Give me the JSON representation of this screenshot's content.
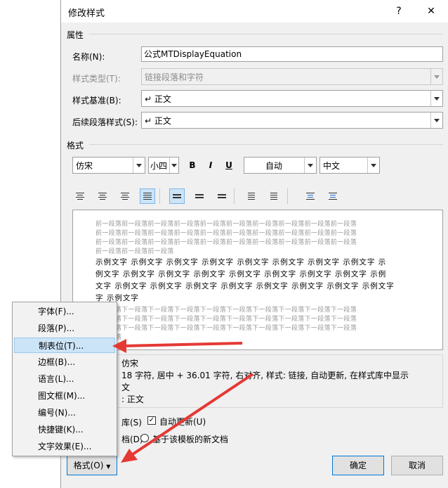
{
  "dialog": {
    "title": "修改样式",
    "help": "?",
    "close": "✕"
  },
  "properties": {
    "section": "属性",
    "name_label": "名称(N):",
    "name_value": "公式MTDisplayEquation",
    "type_label": "样式类型(T):",
    "type_value": "链接段落和字符",
    "based_label": "样式基准(B):",
    "based_value": "↵ 正文",
    "next_label": "后续段落样式(S):",
    "next_value": "↵ 正文"
  },
  "format_section": {
    "section": "格式",
    "font": "仿宋",
    "size": "小四",
    "bold": "B",
    "italic": "I",
    "underline": "U",
    "color": "自动",
    "script": "中文"
  },
  "preview": {
    "prev_lines": [
      "前一段落前一段落前一段落前一段落前一段落前一段落前一段落前一段落前一段落前一段落",
      "前一段落前一段落前一段落前一段落前一段落前一段落前一段落前一段落前一段落前一段落",
      "前一段落前一段落前一段落前一段落前一段落前一段落前一段落前一段落前一段落前一段落",
      "前一段落前一段落前一段落"
    ],
    "sample_lines": [
      "示例文字 示例文字 示例文字 示例文字 示例文字 示例文字 示例文字 示例文字 示",
      "例文字 示例文字 示例文字 示例文字 示例文字 示例文字 示例文字 示例文字 示例",
      "文字 示例文字 示例文字 示例文字 示例文字 示例文字 示例文字 示例文字 示例文字",
      "字 示例文字"
    ],
    "next_lines": [
      "下一段落下一段落下一段落下一段落下一段落下一段落下一段落下一段落下一段落下一段落",
      "下一段落下一段落下一段落下一段落下一段落下一段落下一段落下一段落下一段落下一段落",
      "下一段落下一段落下一段落下一段落下一段落下一段落下一段落下一段落下一段落下一段落",
      "下一段落"
    ]
  },
  "description": {
    "line1": "仿宋",
    "line2": "18 字符, 居中 +  36.01 字符, 右对齐, 样式: 链接, 自动更新, 在样式库中显示",
    "line3": "文",
    "line4": ": 正文"
  },
  "options": {
    "gallery": "库(S)",
    "auto_update": "自动更新(U)",
    "this_doc": "档(D)",
    "new_docs": "基于该模板的新文档"
  },
  "buttons": {
    "format": "格式(O)",
    "ok": "确定",
    "cancel": "取消"
  },
  "menu": {
    "items": [
      "字体(F)...",
      "段落(P)...",
      "制表位(T)...",
      "边框(B)...",
      "语言(L)...",
      "图文框(M)...",
      "编号(N)...",
      "快捷键(K)...",
      "文字效果(E)..."
    ],
    "highlighted_index": 2
  },
  "colors": {
    "accent": "#0078d7",
    "arrow": "#e53935",
    "highlight": "#cce4f7"
  }
}
